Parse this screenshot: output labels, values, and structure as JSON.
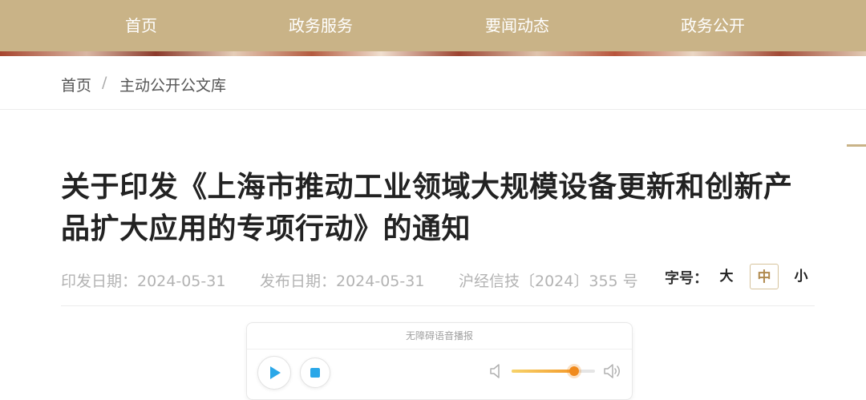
{
  "nav": {
    "items": [
      {
        "label": "首页"
      },
      {
        "label": "政务服务"
      },
      {
        "label": "要闻动态"
      },
      {
        "label": "政务公开"
      }
    ]
  },
  "breadcrumb": {
    "home": "首页",
    "separator": "/",
    "current": "主动公开公文库"
  },
  "article": {
    "title": "关于印发《上海市推动工业领域大规模设备更新和创新产品扩大应用的专项行动》的通知",
    "print_date": "印发日期：2024-05-31",
    "publish_date": "发布日期：2024-05-31",
    "doc_number": "沪经信技〔2024〕355 号"
  },
  "font_size": {
    "label": "字号：",
    "large": "大",
    "medium": "中",
    "small": "小",
    "selected": "中"
  },
  "player": {
    "title": "无障碍语音播报",
    "volume_fraction": 0.75
  },
  "colors": {
    "nav_bg": "#c9b387",
    "accent": "#b08a4e",
    "play_icon": "#2aa7e8",
    "volume": "#f08a1c"
  },
  "icons": [
    "play-icon",
    "stop-icon",
    "volume-low-icon",
    "volume-high-icon"
  ]
}
